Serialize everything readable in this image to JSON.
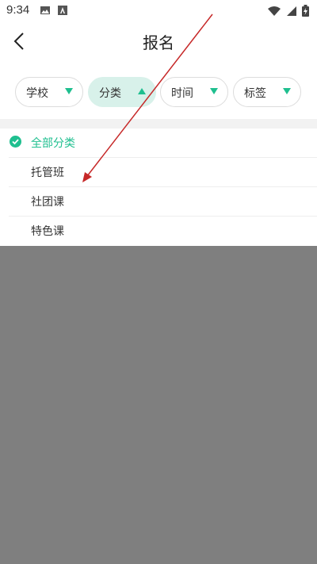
{
  "status_bar": {
    "time": "9:34",
    "icons_left": [
      "image-icon",
      "a-icon"
    ],
    "icons_right": [
      "wifi-icon",
      "signal-icon",
      "battery-icon"
    ]
  },
  "header": {
    "title": "报名"
  },
  "filters": [
    {
      "label": "学校",
      "state": "collapsed"
    },
    {
      "label": "分类",
      "state": "expanded"
    },
    {
      "label": "时间",
      "state": "collapsed"
    },
    {
      "label": "标签",
      "state": "collapsed"
    }
  ],
  "category_list": {
    "items": [
      {
        "label": "全部分类",
        "selected": true
      },
      {
        "label": "托管班",
        "selected": false
      },
      {
        "label": "社团课",
        "selected": false
      },
      {
        "label": "特色课",
        "selected": false
      }
    ]
  },
  "colors": {
    "accent": "#1fbf8f",
    "active_chip_bg": "#d8f1ea",
    "overlay": "#7f7f7f",
    "annotation_arrow": "#c62828"
  }
}
